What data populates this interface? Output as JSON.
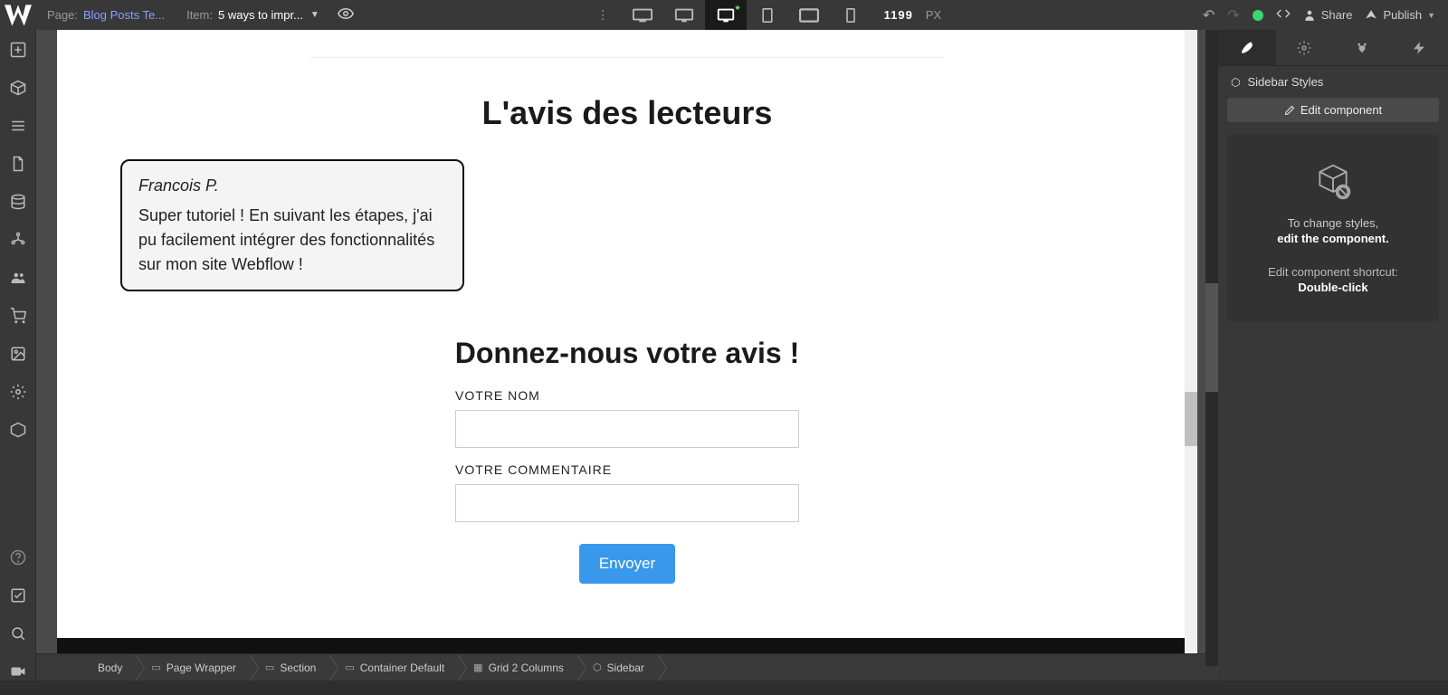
{
  "topbar": {
    "page_label": "Page:",
    "page_name": "Blog Posts Te...",
    "item_label": "Item:",
    "item_name": "5 ways to impr...",
    "px_value": "1199",
    "px_unit": "PX",
    "share_label": "Share",
    "publish_label": "Publish"
  },
  "canvas": {
    "heading_reviews": "L'avis des lecteurs",
    "comment": {
      "author": "Francois P.",
      "text": "Super tutoriel ! En suivant les étapes, j'ai pu facilement intégrer des fonctionnalités sur mon site Webflow !"
    },
    "heading_form": "Donnez-nous votre avis !",
    "label_name": "VOTRE NOM",
    "label_comment": "VOTRE COMMENTAIRE",
    "submit_label": "Envoyer"
  },
  "breadcrumb": {
    "items": [
      {
        "label": "Body"
      },
      {
        "label": "Page Wrapper"
      },
      {
        "label": "Section"
      },
      {
        "label": "Container Default"
      },
      {
        "label": "Grid 2 Columns"
      },
      {
        "label": "Sidebar"
      }
    ]
  },
  "right_panel": {
    "header": "Sidebar Styles",
    "edit_btn": "Edit component",
    "info_line1": "To change styles,",
    "info_line2": "edit the component.",
    "info_line3": "Edit component shortcut:",
    "info_line4": "Double-click"
  }
}
